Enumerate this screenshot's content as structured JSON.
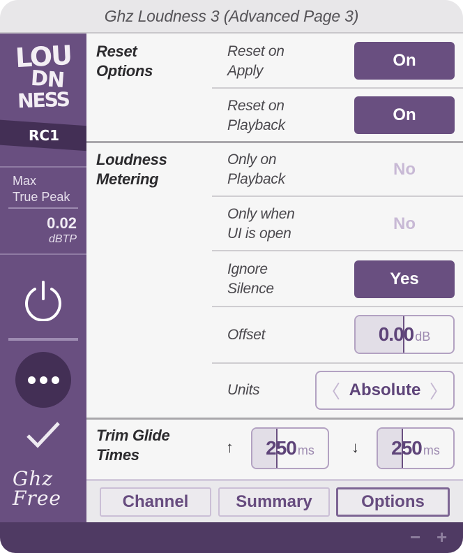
{
  "window": {
    "title": "Ghz Loudness 3 (Advanced Page 3)"
  },
  "sidebar": {
    "logo": {
      "line1": "LOU",
      "line2": "DN",
      "line3": "NESS"
    },
    "preset_badge": "RC1",
    "true_peak": {
      "label_line1": "Max",
      "label_line2": "True Peak",
      "value": "0.02",
      "unit": "dBTP"
    },
    "power_icon": "power-icon",
    "more_icon": "more-horizontal-icon",
    "check_icon": "checkmark-icon",
    "edition": {
      "line1": "Ghz",
      "line2": "Free"
    }
  },
  "sections": {
    "reset": {
      "title_line1": "Reset",
      "title_line2": "Options",
      "rows": [
        {
          "label_line1": "Reset on",
          "label_line2": "Apply",
          "value": "On",
          "state": "on"
        },
        {
          "label_line1": "Reset on",
          "label_line2": "Playback",
          "value": "On",
          "state": "on"
        }
      ]
    },
    "metering": {
      "title_line1": "Loudness",
      "title_line2": "Metering",
      "rows": [
        {
          "label_line1": "Only on",
          "label_line2": "Playback",
          "value": "No",
          "state": "off"
        },
        {
          "label_line1": "Only when",
          "label_line2": "UI is open",
          "value": "No",
          "state": "off"
        },
        {
          "label_line1": "Ignore",
          "label_line2": "Silence",
          "value": "Yes",
          "state": "on"
        }
      ],
      "offset": {
        "label": "Offset",
        "value": "0.00",
        "unit": "dB",
        "fill_fraction": 0.5
      },
      "units": {
        "label": "Units",
        "value": "Absolute",
        "prev_icon": "chevron-left-icon",
        "next_icon": "chevron-right-icon"
      }
    },
    "glide": {
      "title_line1": "Trim Glide",
      "title_line2": "Times",
      "up": {
        "arrow": "↑",
        "value": "250",
        "unit": "ms",
        "fill_fraction": 0.33
      },
      "down": {
        "arrow": "↓",
        "value": "250",
        "unit": "ms",
        "fill_fraction": 0.33
      }
    }
  },
  "tabs": [
    {
      "label": "Channel",
      "active": false
    },
    {
      "label": "Summary",
      "active": false
    },
    {
      "label": "Options",
      "active": true
    }
  ],
  "footer": {
    "zoom_out": "−",
    "zoom_in": "+"
  },
  "colors": {
    "accent": "#694f80",
    "accent_dark": "#432f55",
    "footer": "#4f3a63",
    "toggle_off_text": "#c8b9d5",
    "background": "#f6f6f6"
  }
}
